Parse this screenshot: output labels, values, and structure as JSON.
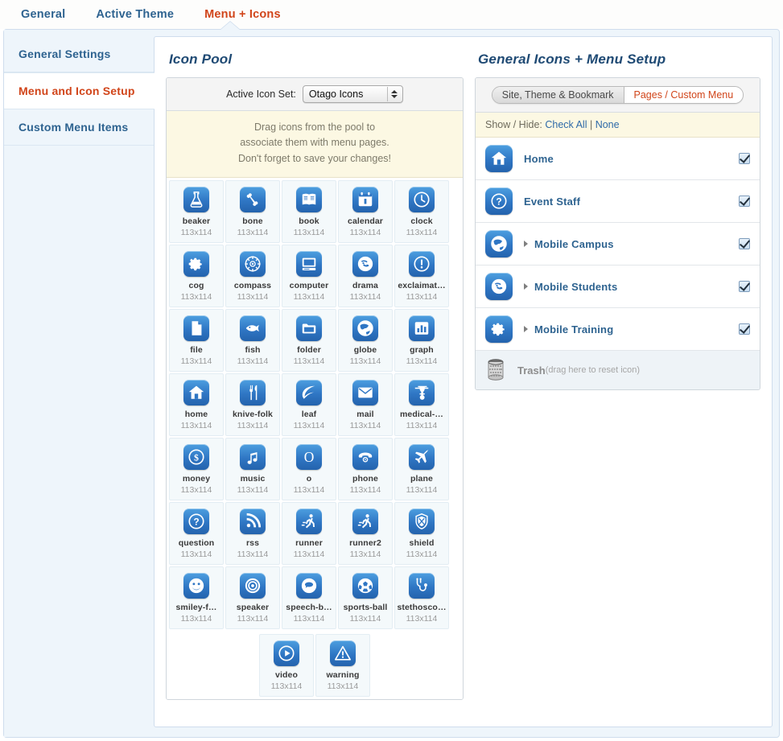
{
  "top_tabs": [
    {
      "label": "General",
      "active": false
    },
    {
      "label": "Active Theme",
      "active": false
    },
    {
      "label": "Menu + Icons",
      "active": true
    }
  ],
  "sidebar": {
    "items": [
      {
        "label": "General Settings",
        "active": false
      },
      {
        "label": "Menu and Icon Setup",
        "active": true
      },
      {
        "label": "Custom Menu Items",
        "active": false
      }
    ]
  },
  "icon_pool": {
    "title": "Icon Pool",
    "active_set_label": "Active Icon Set:",
    "active_set_value": "Otago Icons",
    "note_line1": "Drag icons from the pool to",
    "note_line2": "associate them with menu pages.",
    "note_line3": "Don't forget to save your changes!",
    "icons": [
      {
        "name": "beaker",
        "dim": "113x114",
        "glyph": "beaker"
      },
      {
        "name": "bone",
        "dim": "113x114",
        "glyph": "bone"
      },
      {
        "name": "book",
        "dim": "113x114",
        "glyph": "book"
      },
      {
        "name": "calendar",
        "dim": "113x114",
        "glyph": "calendar"
      },
      {
        "name": "clock",
        "dim": "113x114",
        "glyph": "clock"
      },
      {
        "name": "cog",
        "dim": "113x114",
        "glyph": "cog"
      },
      {
        "name": "compass",
        "dim": "113x114",
        "glyph": "compass"
      },
      {
        "name": "computer",
        "dim": "113x114",
        "glyph": "computer"
      },
      {
        "name": "drama",
        "dim": "113x114",
        "glyph": "drama"
      },
      {
        "name": "exclaimat…",
        "dim": "113x114",
        "glyph": "exclamation"
      },
      {
        "name": "file",
        "dim": "113x114",
        "glyph": "file"
      },
      {
        "name": "fish",
        "dim": "113x114",
        "glyph": "fish"
      },
      {
        "name": "folder",
        "dim": "113x114",
        "glyph": "folder"
      },
      {
        "name": "globe",
        "dim": "113x114",
        "glyph": "globe"
      },
      {
        "name": "graph",
        "dim": "113x114",
        "glyph": "graph"
      },
      {
        "name": "home",
        "dim": "113x114",
        "glyph": "home"
      },
      {
        "name": "knive-folk",
        "dim": "113x114",
        "glyph": "knife-fork"
      },
      {
        "name": "leaf",
        "dim": "113x114",
        "glyph": "leaf"
      },
      {
        "name": "mail",
        "dim": "113x114",
        "glyph": "mail"
      },
      {
        "name": "medical-…",
        "dim": "113x114",
        "glyph": "medical"
      },
      {
        "name": "money",
        "dim": "113x114",
        "glyph": "money"
      },
      {
        "name": "music",
        "dim": "113x114",
        "glyph": "music"
      },
      {
        "name": "o",
        "dim": "113x114",
        "glyph": "letter-o"
      },
      {
        "name": "phone",
        "dim": "113x114",
        "glyph": "phone"
      },
      {
        "name": "plane",
        "dim": "113x114",
        "glyph": "plane"
      },
      {
        "name": "question",
        "dim": "113x114",
        "glyph": "question"
      },
      {
        "name": "rss",
        "dim": "113x114",
        "glyph": "rss"
      },
      {
        "name": "runner",
        "dim": "113x114",
        "glyph": "runner"
      },
      {
        "name": "runner2",
        "dim": "113x114",
        "glyph": "runner"
      },
      {
        "name": "shield",
        "dim": "113x114",
        "glyph": "shield"
      },
      {
        "name": "smiley-f…",
        "dim": "113x114",
        "glyph": "smiley"
      },
      {
        "name": "speaker",
        "dim": "113x114",
        "glyph": "speaker"
      },
      {
        "name": "speech-b…",
        "dim": "113x114",
        "glyph": "speech-bubble"
      },
      {
        "name": "sports-ball",
        "dim": "113x114",
        "glyph": "sports-ball"
      },
      {
        "name": "stethosco…",
        "dim": "113x114",
        "glyph": "stethoscope"
      }
    ],
    "icons_last_row": [
      {
        "name": "video",
        "dim": "113x114",
        "glyph": "video"
      },
      {
        "name": "warning",
        "dim": "113x114",
        "glyph": "warning"
      }
    ]
  },
  "menu_setup": {
    "title": "General Icons + Menu Setup",
    "segments": [
      {
        "label": "Site, Theme & Bookmark",
        "active": false
      },
      {
        "label": "Pages / Custom Menu",
        "active": true
      }
    ],
    "showhide_prefix": "Show / Hide:",
    "check_all": "Check All",
    "separator": "|",
    "none": "None",
    "rows": [
      {
        "label": "Home",
        "glyph": "home",
        "has_caret": false,
        "checked": true
      },
      {
        "label": "Event Staff",
        "glyph": "question",
        "has_caret": false,
        "checked": true
      },
      {
        "label": "Mobile Campus",
        "glyph": "globe",
        "has_caret": true,
        "checked": true
      },
      {
        "label": "Mobile Students",
        "glyph": "drama",
        "has_caret": true,
        "checked": true
      },
      {
        "label": "Mobile Training",
        "glyph": "cog",
        "has_caret": true,
        "checked": true
      }
    ],
    "trash_label": "Trash",
    "trash_hint": "(drag here to reset icon)"
  },
  "colors": {
    "accent_blue": "#2e6390",
    "accent_orange": "#d1451a",
    "icon_blue": "#2f76c4",
    "panel_bg": "#eef5fb",
    "note_bg": "#fcf8e3"
  }
}
